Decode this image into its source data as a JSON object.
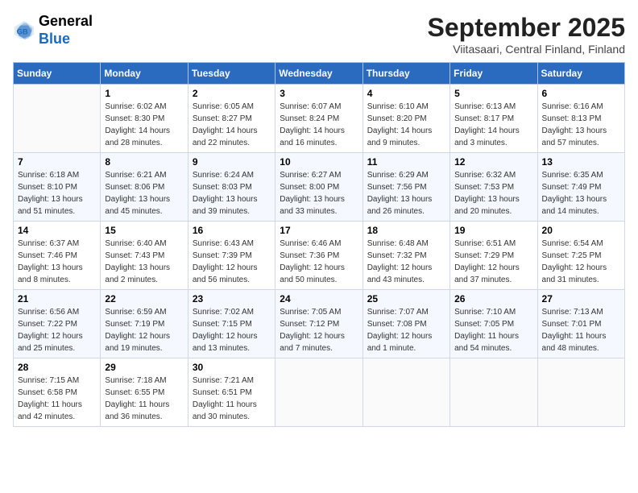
{
  "header": {
    "logo_line1": "General",
    "logo_line2": "Blue",
    "month": "September 2025",
    "location": "Viitasaari, Central Finland, Finland"
  },
  "weekdays": [
    "Sunday",
    "Monday",
    "Tuesday",
    "Wednesday",
    "Thursday",
    "Friday",
    "Saturday"
  ],
  "weeks": [
    [
      {
        "day": "",
        "sunrise": "",
        "sunset": "",
        "daylight": ""
      },
      {
        "day": "1",
        "sunrise": "Sunrise: 6:02 AM",
        "sunset": "Sunset: 8:30 PM",
        "daylight": "Daylight: 14 hours and 28 minutes."
      },
      {
        "day": "2",
        "sunrise": "Sunrise: 6:05 AM",
        "sunset": "Sunset: 8:27 PM",
        "daylight": "Daylight: 14 hours and 22 minutes."
      },
      {
        "day": "3",
        "sunrise": "Sunrise: 6:07 AM",
        "sunset": "Sunset: 8:24 PM",
        "daylight": "Daylight: 14 hours and 16 minutes."
      },
      {
        "day": "4",
        "sunrise": "Sunrise: 6:10 AM",
        "sunset": "Sunset: 8:20 PM",
        "daylight": "Daylight: 14 hours and 9 minutes."
      },
      {
        "day": "5",
        "sunrise": "Sunrise: 6:13 AM",
        "sunset": "Sunset: 8:17 PM",
        "daylight": "Daylight: 14 hours and 3 minutes."
      },
      {
        "day": "6",
        "sunrise": "Sunrise: 6:16 AM",
        "sunset": "Sunset: 8:13 PM",
        "daylight": "Daylight: 13 hours and 57 minutes."
      }
    ],
    [
      {
        "day": "7",
        "sunrise": "Sunrise: 6:18 AM",
        "sunset": "Sunset: 8:10 PM",
        "daylight": "Daylight: 13 hours and 51 minutes."
      },
      {
        "day": "8",
        "sunrise": "Sunrise: 6:21 AM",
        "sunset": "Sunset: 8:06 PM",
        "daylight": "Daylight: 13 hours and 45 minutes."
      },
      {
        "day": "9",
        "sunrise": "Sunrise: 6:24 AM",
        "sunset": "Sunset: 8:03 PM",
        "daylight": "Daylight: 13 hours and 39 minutes."
      },
      {
        "day": "10",
        "sunrise": "Sunrise: 6:27 AM",
        "sunset": "Sunset: 8:00 PM",
        "daylight": "Daylight: 13 hours and 33 minutes."
      },
      {
        "day": "11",
        "sunrise": "Sunrise: 6:29 AM",
        "sunset": "Sunset: 7:56 PM",
        "daylight": "Daylight: 13 hours and 26 minutes."
      },
      {
        "day": "12",
        "sunrise": "Sunrise: 6:32 AM",
        "sunset": "Sunset: 7:53 PM",
        "daylight": "Daylight: 13 hours and 20 minutes."
      },
      {
        "day": "13",
        "sunrise": "Sunrise: 6:35 AM",
        "sunset": "Sunset: 7:49 PM",
        "daylight": "Daylight: 13 hours and 14 minutes."
      }
    ],
    [
      {
        "day": "14",
        "sunrise": "Sunrise: 6:37 AM",
        "sunset": "Sunset: 7:46 PM",
        "daylight": "Daylight: 13 hours and 8 minutes."
      },
      {
        "day": "15",
        "sunrise": "Sunrise: 6:40 AM",
        "sunset": "Sunset: 7:43 PM",
        "daylight": "Daylight: 13 hours and 2 minutes."
      },
      {
        "day": "16",
        "sunrise": "Sunrise: 6:43 AM",
        "sunset": "Sunset: 7:39 PM",
        "daylight": "Daylight: 12 hours and 56 minutes."
      },
      {
        "day": "17",
        "sunrise": "Sunrise: 6:46 AM",
        "sunset": "Sunset: 7:36 PM",
        "daylight": "Daylight: 12 hours and 50 minutes."
      },
      {
        "day": "18",
        "sunrise": "Sunrise: 6:48 AM",
        "sunset": "Sunset: 7:32 PM",
        "daylight": "Daylight: 12 hours and 43 minutes."
      },
      {
        "day": "19",
        "sunrise": "Sunrise: 6:51 AM",
        "sunset": "Sunset: 7:29 PM",
        "daylight": "Daylight: 12 hours and 37 minutes."
      },
      {
        "day": "20",
        "sunrise": "Sunrise: 6:54 AM",
        "sunset": "Sunset: 7:25 PM",
        "daylight": "Daylight: 12 hours and 31 minutes."
      }
    ],
    [
      {
        "day": "21",
        "sunrise": "Sunrise: 6:56 AM",
        "sunset": "Sunset: 7:22 PM",
        "daylight": "Daylight: 12 hours and 25 minutes."
      },
      {
        "day": "22",
        "sunrise": "Sunrise: 6:59 AM",
        "sunset": "Sunset: 7:19 PM",
        "daylight": "Daylight: 12 hours and 19 minutes."
      },
      {
        "day": "23",
        "sunrise": "Sunrise: 7:02 AM",
        "sunset": "Sunset: 7:15 PM",
        "daylight": "Daylight: 12 hours and 13 minutes."
      },
      {
        "day": "24",
        "sunrise": "Sunrise: 7:05 AM",
        "sunset": "Sunset: 7:12 PM",
        "daylight": "Daylight: 12 hours and 7 minutes."
      },
      {
        "day": "25",
        "sunrise": "Sunrise: 7:07 AM",
        "sunset": "Sunset: 7:08 PM",
        "daylight": "Daylight: 12 hours and 1 minute."
      },
      {
        "day": "26",
        "sunrise": "Sunrise: 7:10 AM",
        "sunset": "Sunset: 7:05 PM",
        "daylight": "Daylight: 11 hours and 54 minutes."
      },
      {
        "day": "27",
        "sunrise": "Sunrise: 7:13 AM",
        "sunset": "Sunset: 7:01 PM",
        "daylight": "Daylight: 11 hours and 48 minutes."
      }
    ],
    [
      {
        "day": "28",
        "sunrise": "Sunrise: 7:15 AM",
        "sunset": "Sunset: 6:58 PM",
        "daylight": "Daylight: 11 hours and 42 minutes."
      },
      {
        "day": "29",
        "sunrise": "Sunrise: 7:18 AM",
        "sunset": "Sunset: 6:55 PM",
        "daylight": "Daylight: 11 hours and 36 minutes."
      },
      {
        "day": "30",
        "sunrise": "Sunrise: 7:21 AM",
        "sunset": "Sunset: 6:51 PM",
        "daylight": "Daylight: 11 hours and 30 minutes."
      },
      {
        "day": "",
        "sunrise": "",
        "sunset": "",
        "daylight": ""
      },
      {
        "day": "",
        "sunrise": "",
        "sunset": "",
        "daylight": ""
      },
      {
        "day": "",
        "sunrise": "",
        "sunset": "",
        "daylight": ""
      },
      {
        "day": "",
        "sunrise": "",
        "sunset": "",
        "daylight": ""
      }
    ]
  ]
}
